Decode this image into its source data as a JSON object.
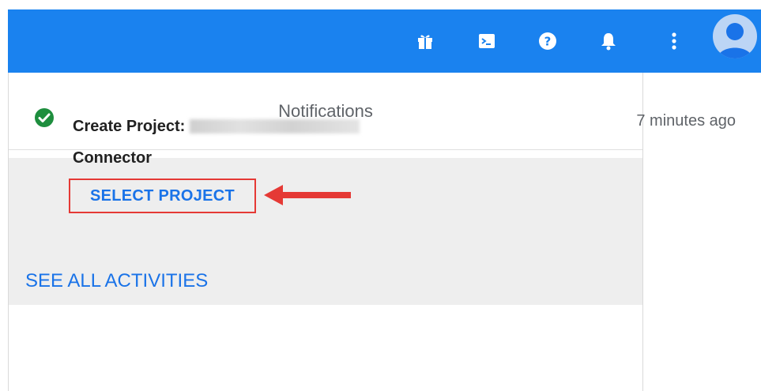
{
  "topbar": {
    "color": "#1a82ef",
    "icons": [
      "gift-icon",
      "cloud-shell-icon",
      "help-icon",
      "notifications-bell-icon",
      "more-vert-icon",
      "account-avatar-icon"
    ]
  },
  "notifications": {
    "title": "Notifications",
    "item": {
      "status_icon": "check-circle-icon",
      "title_prefix": "Create Project:",
      "title_suffix": "Connector",
      "time": "7 minutes ago",
      "action_label": "SELECT PROJECT"
    },
    "see_all_label": "SEE ALL ACTIVITIES"
  },
  "annotation": {
    "color": "#e53935"
  }
}
